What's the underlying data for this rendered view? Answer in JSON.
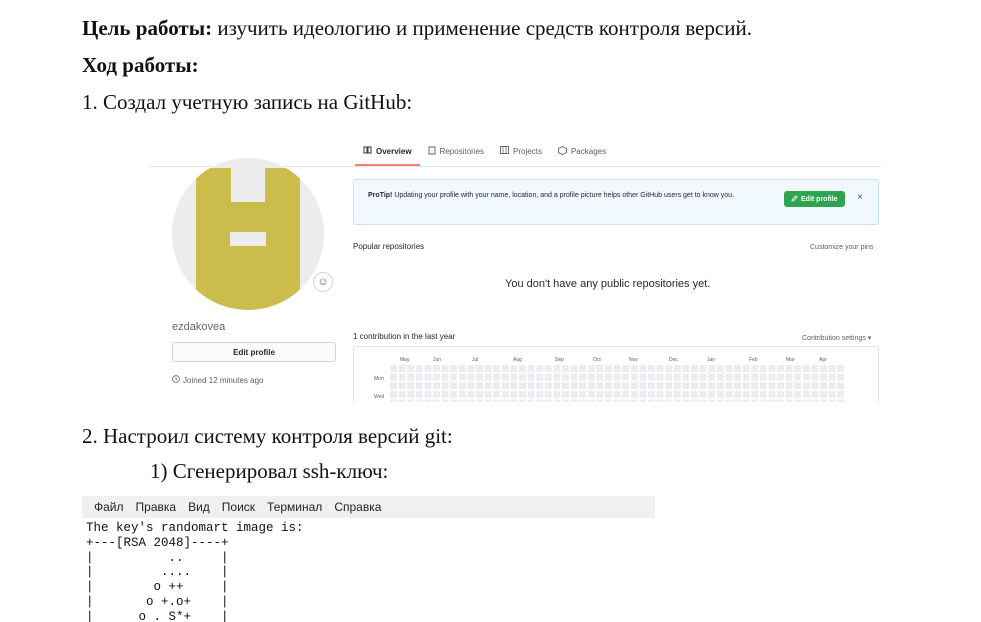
{
  "doc": {
    "goal_label": "Цель работы:",
    "goal_text": " изучить идеологию и применение средств контроля версий.",
    "progress_heading": "Ход работы:",
    "step1": "1. Создал учетную запись на GitHub:",
    "step2": "2. Настроил систему контроля версий git:",
    "step2_1": "1) Сгенерировал ssh-ключ:"
  },
  "github": {
    "tabs": [
      "Overview",
      "Repositories",
      "Projects",
      "Packages"
    ],
    "active_tab": "Overview",
    "username": "ezdakovea",
    "edit_profile": "Edit profile",
    "joined": "Joined 12 minutes ago",
    "protip_label": "ProTip!",
    "protip_text": " Updating your profile with your name, location, and a profile picture helps other GitHub users get to know you.",
    "protip_button": "Edit profile",
    "protip_close": "×",
    "popular": "Popular repositories",
    "customize": "Customize your pins",
    "no_repos": "You don't have any public repositories yet.",
    "contributions": "1 contribution in the last year",
    "contribution_settings": "Contribution settings ▾",
    "months": [
      "May",
      "Jun",
      "Jul",
      "Aug",
      "Sep",
      "Oct",
      "Nov",
      "Dec",
      "Jan",
      "Feb",
      "Mar",
      "Apr"
    ],
    "day_labels": [
      "Mon",
      "Wed"
    ],
    "avatar_color": "#cbbd4c",
    "accent_color": "#2ea44f"
  },
  "terminal": {
    "menu": [
      "Файл",
      "Правка",
      "Вид",
      "Поиск",
      "Терминал",
      "Справка"
    ],
    "lines": [
      "The key's randomart image is:",
      "+---[RSA 2048]----+",
      "|          ..     |",
      "|         ....    |",
      "|        o ++     |",
      "|       o +.o+    |",
      "|      o . S*+    |"
    ]
  }
}
